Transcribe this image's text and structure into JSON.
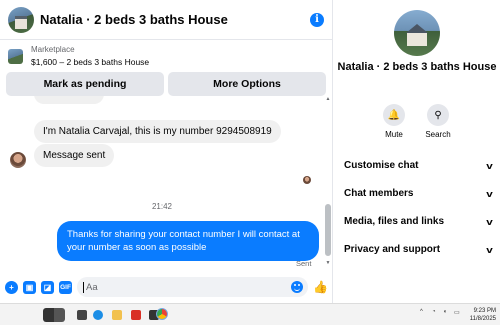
{
  "chat": {
    "header_title": "Natalia · 2 beds 3 baths House",
    "info_icon": "info-icon",
    "marketplace_label": "Marketplace",
    "marketplace_listing": "$1,600 – 2 beds 3 baths House",
    "mark_pending_label": "Mark as pending",
    "more_options_label": "More Options",
    "messages": {
      "incoming_1": "I'm Natalia Carvajal, this is my number 9294508919",
      "incoming_2": "Message sent",
      "timestamp": "21:42",
      "outgoing_1": "Thanks for sharing your contact number I will contact at your number as soon as possible",
      "sent_status": "Sent"
    },
    "composer": {
      "placeholder": "Aa",
      "icons": [
        "plus-icon",
        "photo-icon",
        "sticker-icon",
        "gif-icon",
        "emoji-icon",
        "like-icon"
      ],
      "gif_label": "GIF"
    }
  },
  "side": {
    "title": "Natalia · 2 beds 3 baths House",
    "mute_label": "Mute",
    "search_label": "Search",
    "menu": [
      {
        "label": "Customise chat"
      },
      {
        "label": "Chat members"
      },
      {
        "label": "Media, files and links"
      },
      {
        "label": "Privacy and support"
      }
    ]
  },
  "taskbar": {
    "time": "9:23 PM",
    "date": "11/8/2025"
  },
  "colors": {
    "accent": "#0a7cff",
    "bubble_incoming": "#f0f0f0",
    "button_bg": "#e4e6eb"
  }
}
